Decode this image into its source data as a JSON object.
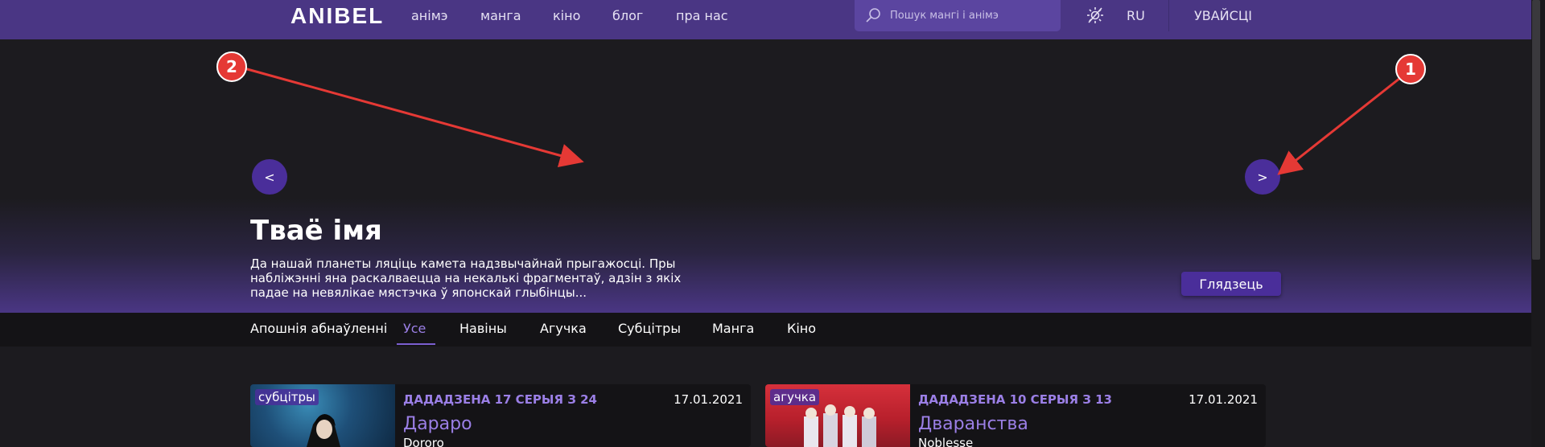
{
  "nav": {
    "logo": "ANIBEL",
    "links": [
      "анімэ",
      "манга",
      "кіно",
      "блог",
      "пра нас"
    ],
    "search_placeholder": "Пошук мангі і анімэ",
    "lang": "RU",
    "login": "УВАЙСЦІ"
  },
  "hero": {
    "prev_label": "<",
    "next_label": ">",
    "title": "Тваё імя",
    "description": "Да нашай планеты ляціць камета надзвычайнай прыгажосці. Пры набліжэнні яна раскалваецца на некалькі фрагментаў, адзін з якіх падае на невялікае мястэчка ў японскай глыбінцы...",
    "watch_label": "Глядзець"
  },
  "annotations": [
    "1",
    "2"
  ],
  "tabs": {
    "title": "Апошнія абнаўленні",
    "items": [
      "Усе",
      "Навіны",
      "Агучка",
      "Субцітры",
      "Манга",
      "Кіно"
    ],
    "active": "Усе"
  },
  "cards": [
    {
      "badge": "субцітры",
      "status": "ДАДАДЗЕНА 17 СЕРЫЯ З 24",
      "date": "17.01.2021",
      "title": "Дараро",
      "subtitle": "Dororo"
    },
    {
      "badge": "агучка",
      "status": "ДАДАДЗЕНА 10 СЕРЫЯ З 13",
      "date": "17.01.2021",
      "title": "Дваранства",
      "subtitle": "Noblesse"
    }
  ],
  "colors": {
    "accent": "#4a3684",
    "button": "#4a2e9a",
    "highlight": "#9b7fe6",
    "annotation": "#e53935"
  }
}
